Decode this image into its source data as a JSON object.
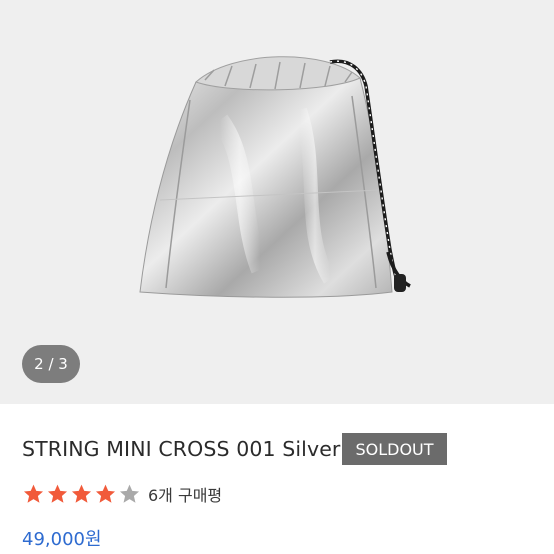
{
  "gallery": {
    "counter": "2 / 3",
    "image_alt": "silver drawstring pouch"
  },
  "product": {
    "title": "STRING MINI CROSS 001 Silver",
    "status_badge": "SOLDOUT",
    "rating": 4,
    "rating_max": 5,
    "review_text": "6개 구매평",
    "price": "49,000원"
  },
  "colors": {
    "star_filled": "#f15a3a",
    "star_empty": "#a9a9a9",
    "price": "#2e6bd0",
    "badge_bg": "#6b6b6b",
    "counter_bg": "#7d7d7d"
  }
}
